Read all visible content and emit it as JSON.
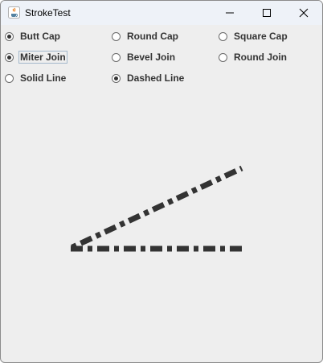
{
  "window": {
    "title": "StrokeTest",
    "icon": "java-cup-icon",
    "controls": [
      "minimize-icon",
      "maximize-icon",
      "close-icon"
    ]
  },
  "options": {
    "cap": {
      "items": [
        {
          "label": "Butt Cap",
          "checked": true
        },
        {
          "label": "Round Cap",
          "checked": false
        },
        {
          "label": "Square Cap",
          "checked": false
        }
      ]
    },
    "join": {
      "items": [
        {
          "label": "Miter Join",
          "checked": true,
          "focused": true
        },
        {
          "label": "Bevel Join",
          "checked": false
        },
        {
          "label": "Round Join",
          "checked": false
        }
      ]
    },
    "line": {
      "items": [
        {
          "label": "Solid Line",
          "checked": false
        },
        {
          "label": "Dashed Line",
          "checked": true
        }
      ]
    }
  },
  "drawing": {
    "stroke_color": "#333333",
    "cap": "butt",
    "join": "miter",
    "dashed": true
  }
}
